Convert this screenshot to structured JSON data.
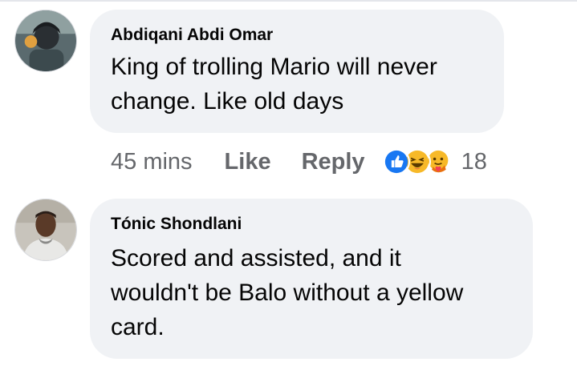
{
  "comments": [
    {
      "author": "Abdiqani Abdi Omar",
      "lines": [
        "King of trolling Mario will never",
        "change. Like old days"
      ],
      "time": "45 mins",
      "like_label": "Like",
      "reply_label": "Reply",
      "reactions": [
        "like-icon",
        "haha-icon",
        "care-icon"
      ],
      "reaction_count": "18"
    },
    {
      "author": "Tónic Shondlani",
      "lines": [
        "Scored and assisted, and it",
        "wouldn't be Balo without a yellow",
        "card."
      ]
    }
  ],
  "colors": {
    "bubble": "#f0f2f5",
    "meta_text": "#65676b",
    "like_blue": "#1877f2",
    "haha_yellow": "#f7b928"
  }
}
